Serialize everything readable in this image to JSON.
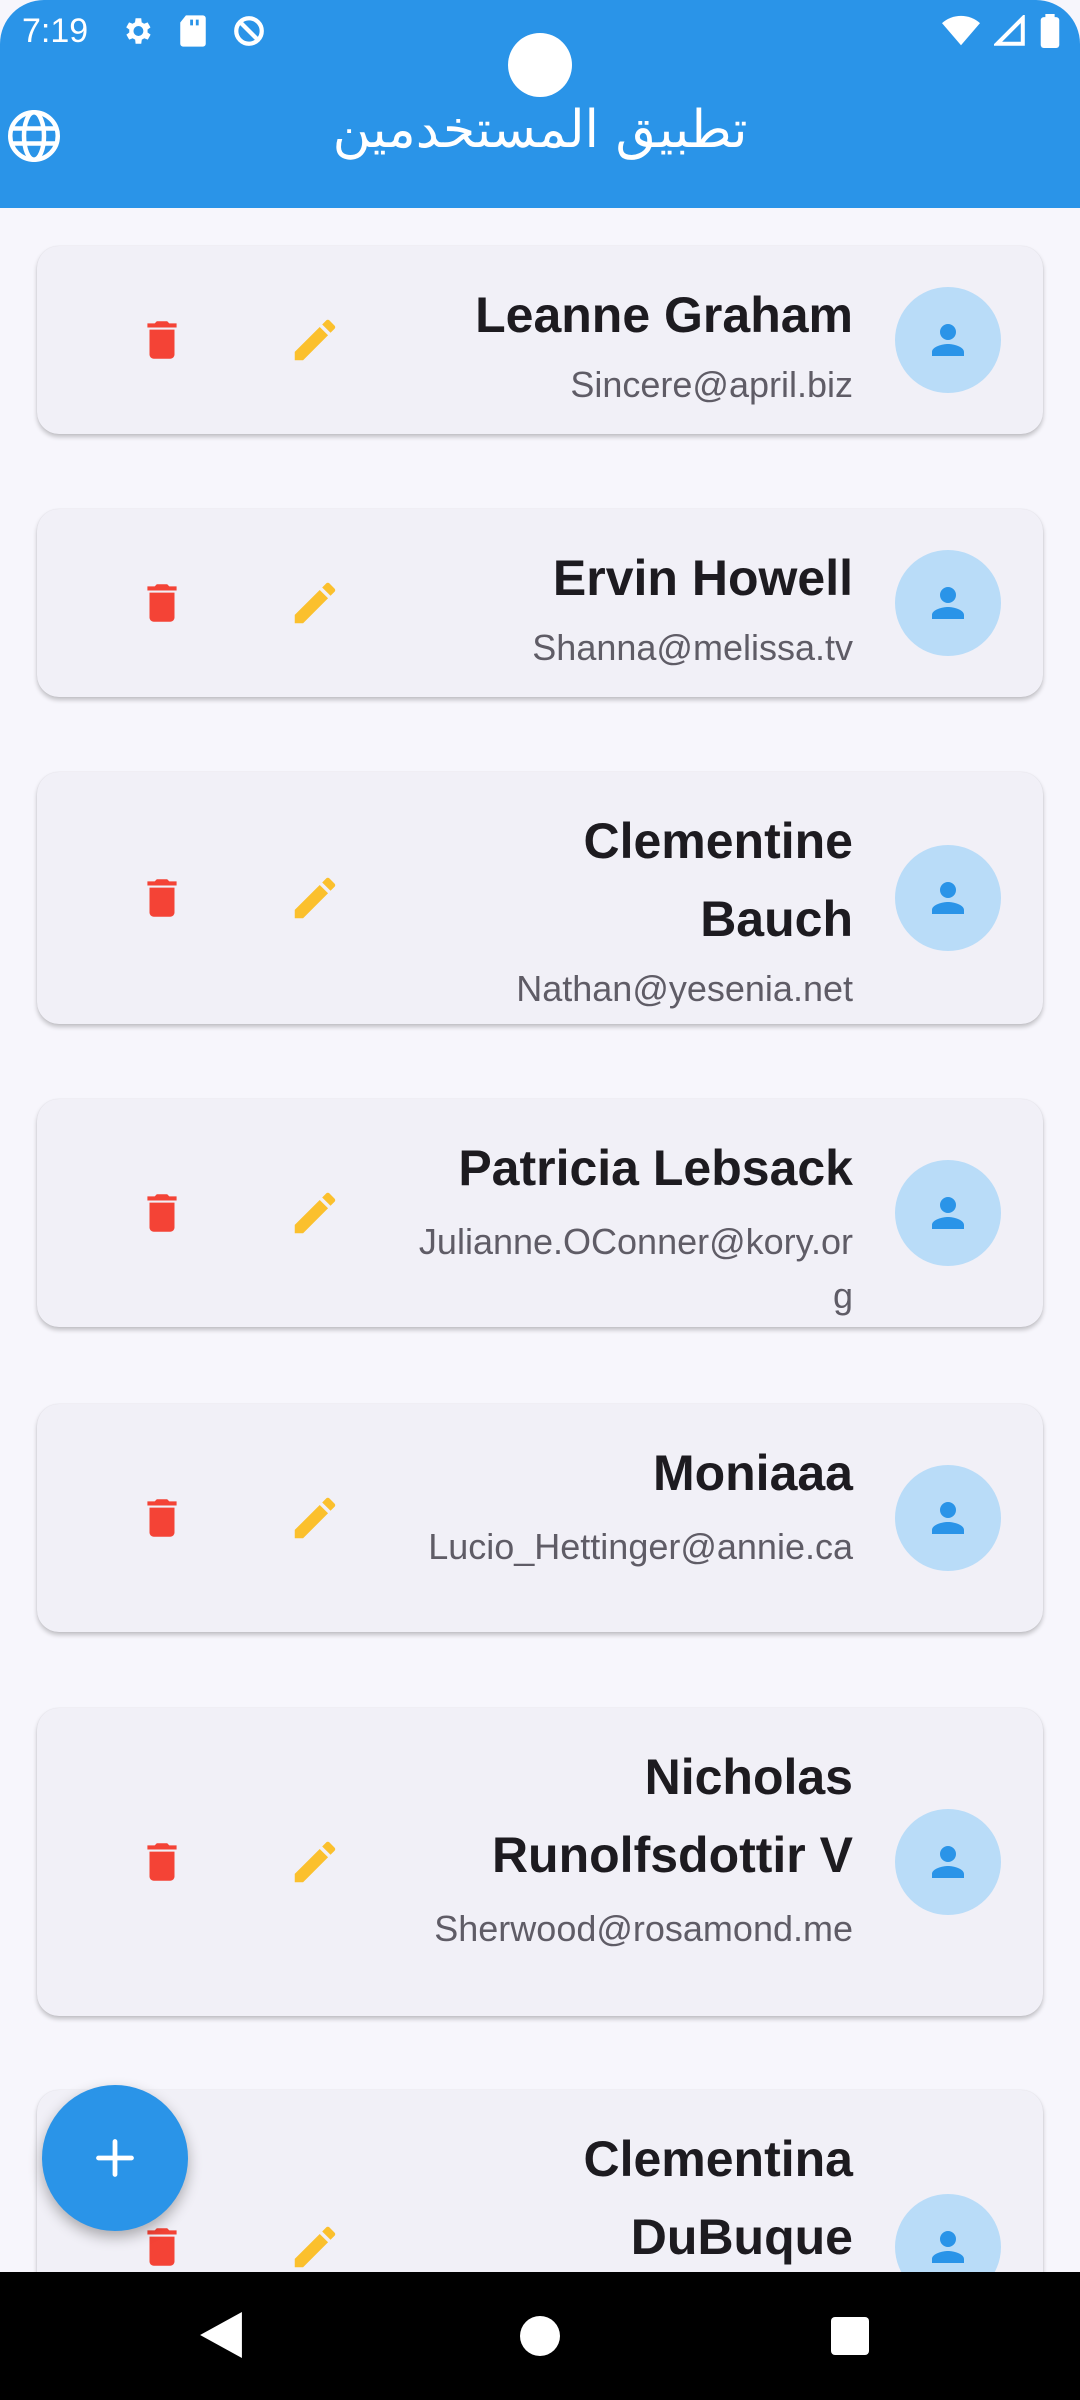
{
  "status_bar": {
    "time": "7:19",
    "left_icons": [
      "gear-icon",
      "sd-card-icon",
      "do-not-disturb-icon"
    ],
    "right_icons": [
      "wifi-icon",
      "signal-icon",
      "battery-icon"
    ]
  },
  "app_bar": {
    "title": "تطبيق المستخدمين",
    "language_icon": "globe-icon",
    "color": "#2a94e8"
  },
  "users": [
    {
      "name": "Leanne Graham",
      "email": "Sincere@april.biz"
    },
    {
      "name": "Ervin Howell",
      "email": "Shanna@melissa.tv"
    },
    {
      "name": "Clementine Bauch",
      "email": "Nathan@yesenia.net"
    },
    {
      "name": "Patricia Lebsack",
      "email": "Julianne.OConner@kory.org"
    },
    {
      "name": "Moniaaa",
      "email": "Lucio_Hettinger@annie.ca"
    },
    {
      "name": "Nicholas Runolfsdottir V",
      "email": "Sherwood@rosamond.me"
    },
    {
      "name": "Clementina DuBuque",
      "email": ""
    }
  ],
  "card_actions": {
    "delete_icon": "trash-icon",
    "edit_icon": "pencil-icon",
    "delete_color": "#f44336",
    "edit_color": "#fbc02d",
    "avatar_icon": "person-icon"
  },
  "fab": {
    "icon": "plus-icon"
  },
  "nav_bar": {
    "icons": [
      "back-icon",
      "home-icon",
      "recents-icon"
    ]
  }
}
